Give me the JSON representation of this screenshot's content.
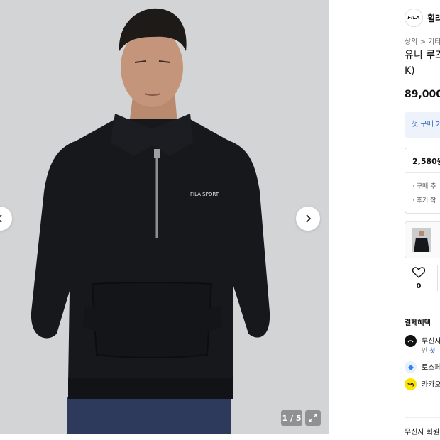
{
  "gallery": {
    "counter": "1 / 5",
    "prev_icon": "chevron-left-icon",
    "next_icon": "chevron-right-icon",
    "expand_icon": "expand-icon",
    "chest_logo": "FILA SPORT"
  },
  "brand": {
    "logo_text": "FILA",
    "name": "휠라"
  },
  "breadcrumb": "상의 > 기타",
  "product": {
    "title_line1": "유니 루즈",
    "title_line2": "K)",
    "price": "89,000"
  },
  "coupon": {
    "label": "첫 구매 2"
  },
  "points": {
    "amount": "2,580원",
    "line1": "· 구매 추",
    "line2": "· 후기 작"
  },
  "like": {
    "icon": "heart-icon",
    "count": "0"
  },
  "benefits": {
    "title": "결제혜택",
    "musinsa_line1": "무신사",
    "musinsa_line2_prefix": "인 ",
    "musinsa_line2_highlight": "첫",
    "toss": "토스페",
    "kakao": "카카오",
    "kakao_icon_text": "pay"
  },
  "member": "무신사 회원"
}
